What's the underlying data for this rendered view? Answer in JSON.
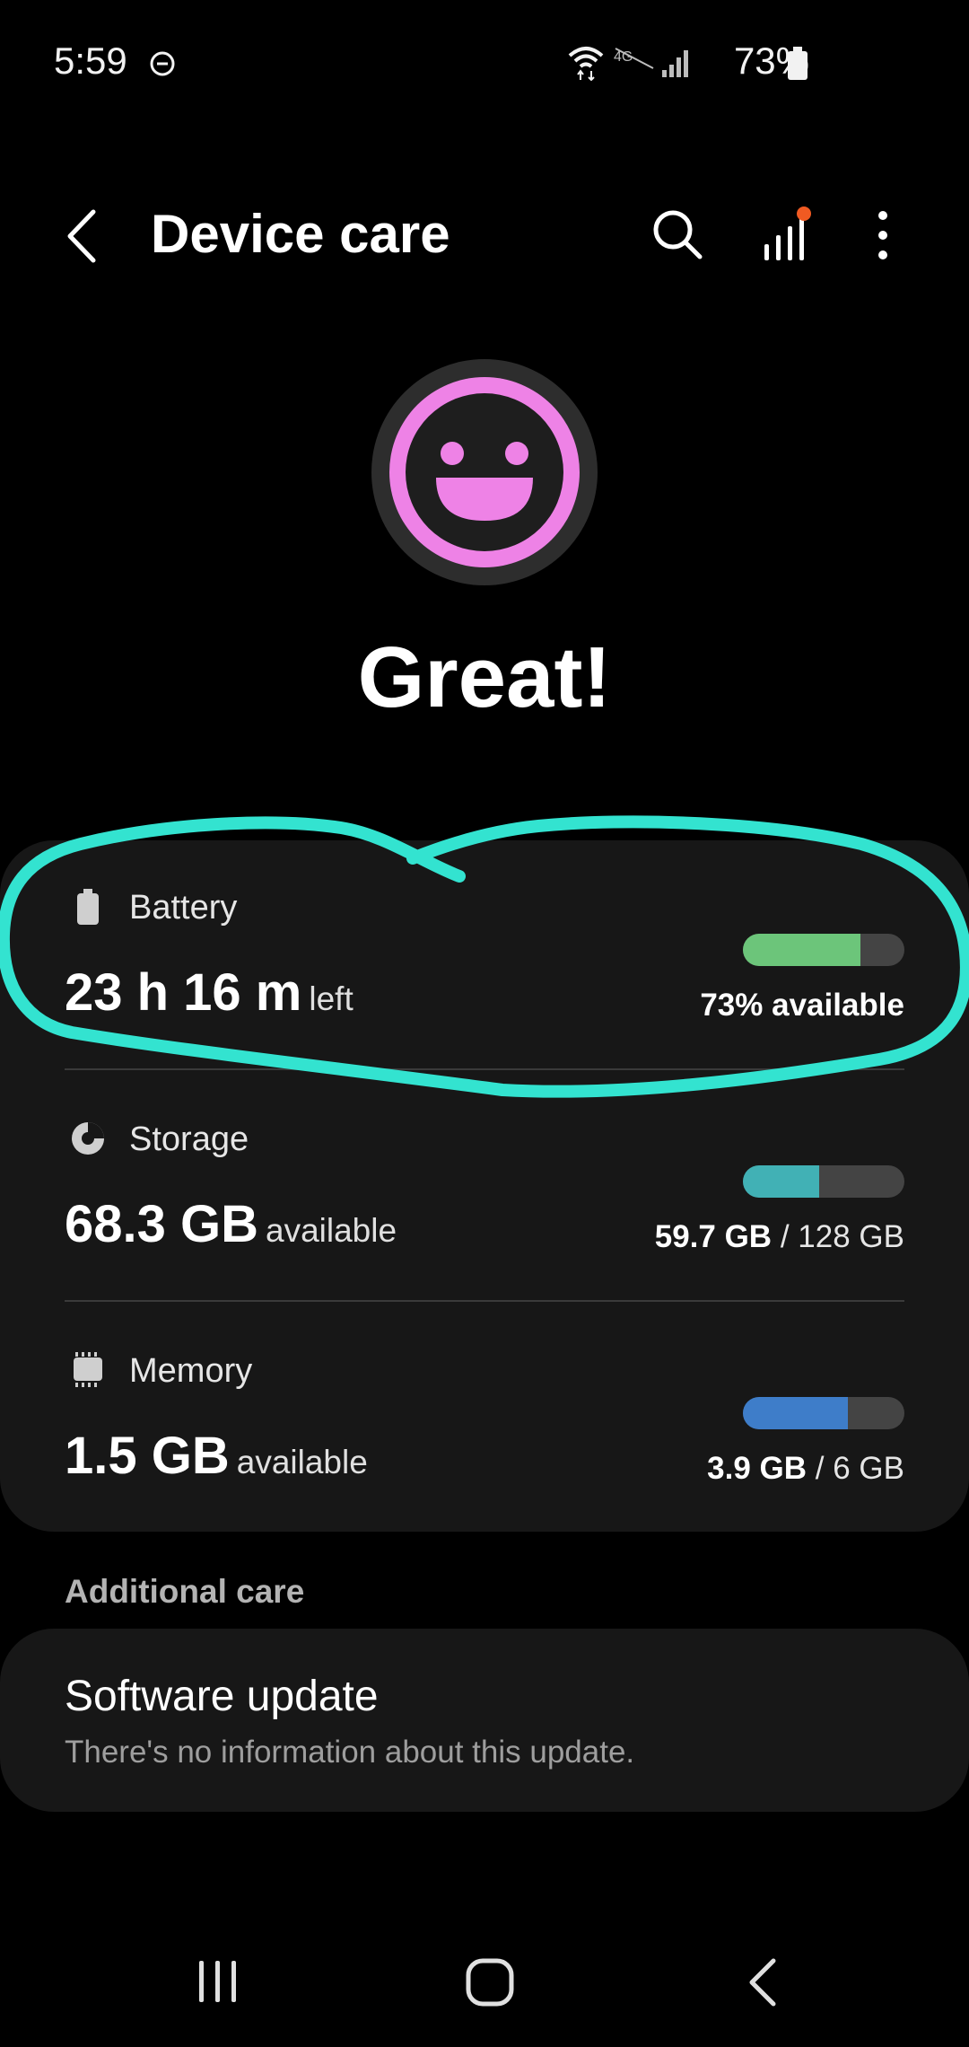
{
  "status_bar": {
    "time": "5:59",
    "lte_text": "4G",
    "battery_percent": "73%"
  },
  "header": {
    "title": "Device care"
  },
  "status": {
    "heading": "Great!"
  },
  "battery": {
    "label": "Battery",
    "value": "23 h 16 m",
    "suffix": "left",
    "right_text": "73% available",
    "fill_fraction": 0.73,
    "color": "#6cc57a"
  },
  "storage": {
    "label": "Storage",
    "value": "68.3 GB",
    "suffix": "available",
    "used": "59.7 GB",
    "sep": "/",
    "total": "128 GB",
    "fill_fraction": 0.47,
    "color": "#41b1b5"
  },
  "memory": {
    "label": "Memory",
    "value": "1.5 GB",
    "suffix": "available",
    "used": "3.9 GB",
    "sep": "/",
    "total": "6 GB",
    "fill_fraction": 0.65,
    "color": "#3e7dc9"
  },
  "additional_care": {
    "section_label": "Additional care",
    "software_update": {
      "title": "Software update",
      "subtitle": "There's no information about this update."
    }
  },
  "colors": {
    "face_pink": "#ee82e6",
    "annotation": "#33e3d0",
    "notification_dot": "#f05a22"
  }
}
